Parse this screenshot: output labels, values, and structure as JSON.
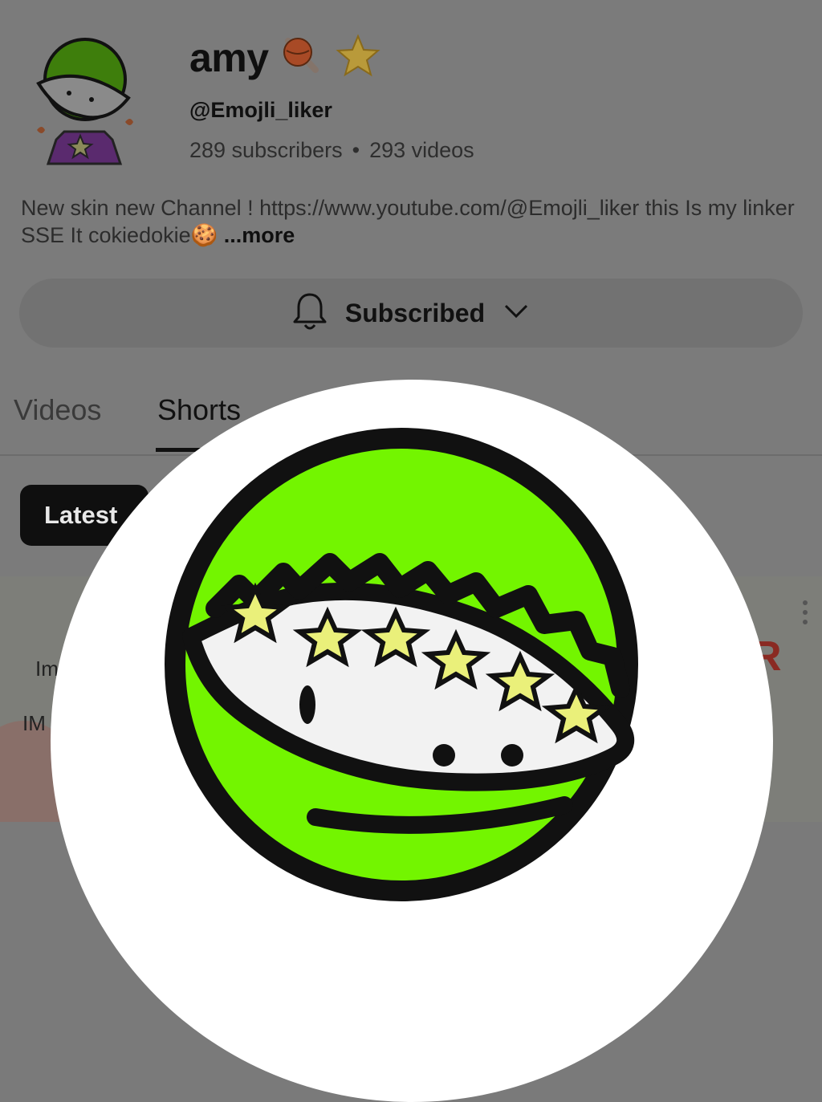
{
  "channel": {
    "name": "amy",
    "handle": "@Emojli_liker",
    "subscribers": "289 subscribers",
    "videos": "293 videos",
    "separator": "•",
    "description": "New skin new Channel ! https://www.youtube.com/@Emojli_liker this Is my linker SSE It cokiedokie🍪",
    "more_label": "...more"
  },
  "subscribe_button": {
    "label": "Subscribed",
    "icons": [
      "bell-icon",
      "chevron-down-icon"
    ]
  },
  "tabs": [
    {
      "label": "Videos",
      "selected": false
    },
    {
      "label": "Shorts",
      "selected": true
    }
  ],
  "filter_chips": [
    {
      "label": "Latest",
      "selected": true
    }
  ],
  "video_card": {
    "text_line1": "Im",
    "text_line2": "IM",
    "corner_letter": "R"
  },
  "colors": {
    "overlay_background": "#ffffff",
    "avatar_green": "#73f500",
    "dim_background": "#7b7b7b",
    "star_yellow": "#e9ec9a",
    "shirt_purple": "#7b2fa8"
  }
}
